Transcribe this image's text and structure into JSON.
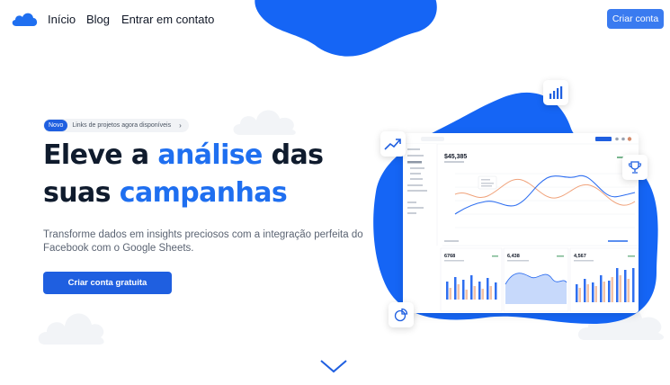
{
  "nav": {
    "links": [
      "Início",
      "Blog",
      "Entrar em contato"
    ],
    "cta": "Criar conta"
  },
  "hero": {
    "badge_pill": "Novo",
    "badge_text": "Links de projetos agora disponíveis",
    "headline_1a": "Eleve a ",
    "headline_1b": "análise",
    "headline_1c": " das",
    "headline_2a": "suas ",
    "headline_2b": "campanhas",
    "subtitle": "Transforme dados em insights preciosos com a integração perfeita do Facebook com o Google Sheets.",
    "cta": "Criar conta gratuita"
  },
  "dashboard": {
    "main_value": "$45,385",
    "stats": [
      "6768",
      "6,438",
      "4,567"
    ]
  },
  "colors": {
    "brand": "#1f5fe0",
    "accent": "#1f6ff0",
    "blob": "#1565f5"
  },
  "icons": [
    "cloud-logo-icon",
    "trend-up-icon",
    "bar-chart-icon",
    "trophy-icon",
    "pie-chart-icon",
    "chevron-down-icon"
  ]
}
